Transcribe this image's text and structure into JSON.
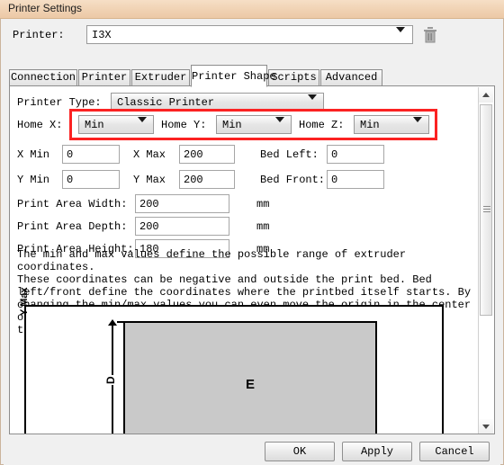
{
  "window": {
    "title": "Printer Settings"
  },
  "printer_row": {
    "label": "Printer:",
    "value": "I3X",
    "delete_icon": "trash-icon"
  },
  "tabs": [
    {
      "label": "Connection",
      "active": false
    },
    {
      "label": "Printer",
      "active": false
    },
    {
      "label": "Extruder",
      "active": false
    },
    {
      "label": "Printer Shape",
      "active": true
    },
    {
      "label": "Scripts",
      "active": false
    },
    {
      "label": "Advanced",
      "active": false
    }
  ],
  "form": {
    "printer_type_label": "Printer Type:",
    "printer_type_value": "Classic Printer",
    "home_x_label": "Home X:",
    "home_x_value": "Min",
    "home_y_label": "Home Y:",
    "home_y_value": "Min",
    "home_z_label": "Home Z:",
    "home_z_value": "Min",
    "x_min_label": "X Min",
    "x_min_value": "0",
    "x_max_label": "X Max",
    "x_max_value": "200",
    "y_min_label": "Y Min",
    "y_min_value": "0",
    "y_max_label": "Y Max",
    "y_max_value": "200",
    "bed_left_label": "Bed Left:",
    "bed_left_value": "0",
    "bed_front_label": "Bed Front:",
    "bed_front_value": "0",
    "print_area_width_label": "Print Area Width:",
    "print_area_width_value": "200",
    "print_area_width_unit": "mm",
    "print_area_depth_label": "Print Area Depth:",
    "print_area_depth_value": "200",
    "print_area_depth_unit": "mm",
    "print_area_height_label": "Print Area Height:",
    "print_area_height_value": "180",
    "print_area_height_unit": "mm",
    "description": "The min and max values define the possible range of extruder coordinates.\nThese coordinates can be negative and outside the print bed. Bed\nleft/front define the coordinates where the printbed itself starts. By\nchanging the min/max values you can even move the origin in the center of\nthe print bed, if supported by firmware."
  },
  "diagram": {
    "y_max_label": "Y Max",
    "depth_label": "D",
    "bed_label": "E"
  },
  "footer": {
    "ok_label": "OK",
    "apply_label": "Apply",
    "cancel_label": "Cancel"
  },
  "colors": {
    "titlebar": "#f0d2b3",
    "highlight": "#fb2222",
    "bed_fill": "#c9c9c9",
    "panel": "#f0f0f0"
  }
}
